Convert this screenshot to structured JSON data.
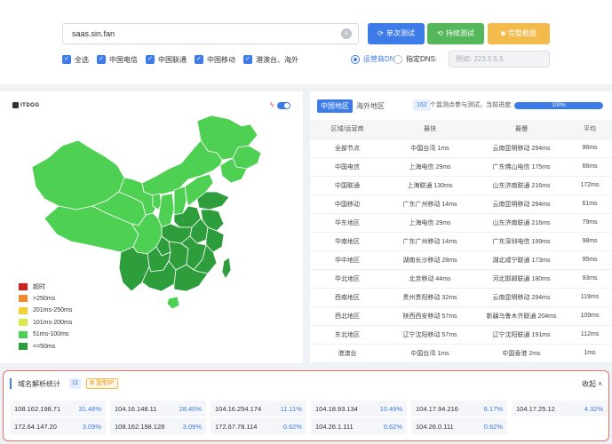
{
  "search": {
    "value": "saas.sin.fan",
    "clear_label": "×"
  },
  "buttons": {
    "single_test": "单次测试",
    "continuous_test": "持续测试",
    "full_screenshot": "完整截图"
  },
  "filters": [
    {
      "label": "全选",
      "checked": true
    },
    {
      "label": "中国电信",
      "checked": true
    },
    {
      "label": "中国联通",
      "checked": true
    },
    {
      "label": "中国移动",
      "checked": true
    },
    {
      "label": "港澳台、海外",
      "checked": true
    }
  ],
  "dns": {
    "isp_label": "运营商DNS",
    "custom_label": "指定DNS:",
    "custom_placeholder": "例如: 223.5.5.5",
    "selected": "isp"
  },
  "map": {
    "logo": "ITDOG",
    "colors": {
      "dark": "#2e9e3c",
      "light": "#4ed053",
      "stroke": "#ffffff"
    },
    "legend": [
      {
        "label": "超时",
        "color": "#d11f1f"
      },
      {
        "label": ">250ms",
        "color": "#f08a2a"
      },
      {
        "label": "201ms-250ms",
        "color": "#f2d232"
      },
      {
        "label": "101ms-200ms",
        "color": "#dce84b"
      },
      {
        "label": "51ms-100ms",
        "color": "#4ed053"
      },
      {
        "label": "<=50ms",
        "color": "#2e9e3c"
      }
    ]
  },
  "stats": {
    "tabs": {
      "mainland": "中国地区",
      "overseas": "海外地区"
    },
    "node_count": "162",
    "progress_text": "个监测点参与测试，当前进度:",
    "progress_label": "100%",
    "progress_fraction": 1.0,
    "headers": [
      "区域/运营商",
      "最快",
      "最慢",
      "平均"
    ],
    "rows": [
      [
        "全部节点",
        "中国台湾 1ms",
        "云南昆明移动 294ms",
        "96ms"
      ],
      [
        "中国电信",
        "上海电信 29ms",
        "广东佛山电信 175ms",
        "66ms"
      ],
      [
        "中国联通",
        "上海联通 130ms",
        "山东济南联通 216ms",
        "172ms"
      ],
      [
        "中国移动",
        "广东广州移动 14ms",
        "云南昆明移动 294ms",
        "61ms"
      ],
      [
        "华东地区",
        "上海电信 29ms",
        "山东济南联通 216ms",
        "79ms"
      ],
      [
        "华南地区",
        "广东广州移动 14ms",
        "广东深圳电信 199ms",
        "98ms"
      ],
      [
        "华中地区",
        "湖南长沙移动 28ms",
        "湖北咸宁联通 173ms",
        "95ms"
      ],
      [
        "华北地区",
        "北京移动 44ms",
        "河北邯郸联通 180ms",
        "93ms"
      ],
      [
        "西南地区",
        "贵州贵阳移动 32ms",
        "云南昆明移动 294ms",
        "119ms"
      ],
      [
        "西北地区",
        "陕西西安移动 57ms",
        "新疆乌鲁木齐联通 204ms",
        "109ms"
      ],
      [
        "东北地区",
        "辽宁沈阳移动 57ms",
        "辽宁沈阳联通 191ms",
        "112ms"
      ],
      [
        "港澳台",
        "中国台湾 1ms",
        "中国香港 2ms",
        "1ms"
      ]
    ]
  },
  "dns_stats": {
    "title": "域名解析统计",
    "count": "11",
    "copy_label": "复制IP",
    "collapse_label": "收起",
    "ips": [
      {
        "ip": "108.162.198.71",
        "pct": "31.48%"
      },
      {
        "ip": "104.16.148.11",
        "pct": "28.40%"
      },
      {
        "ip": "104.16.254.174",
        "pct": "11.11%"
      },
      {
        "ip": "104.18.93.134",
        "pct": "10.49%"
      },
      {
        "ip": "104.17.94.216",
        "pct": "6.17%"
      },
      {
        "ip": "104.17.25.12",
        "pct": "4.32%"
      },
      {
        "ip": "172.64.147.20",
        "pct": "3.09%"
      },
      {
        "ip": "108.162.198.128",
        "pct": "3.09%"
      },
      {
        "ip": "172.67.78.114",
        "pct": "0.62%"
      },
      {
        "ip": "104.26.1.111",
        "pct": "0.62%"
      },
      {
        "ip": "104.26.0.111",
        "pct": "0.62%"
      }
    ]
  }
}
